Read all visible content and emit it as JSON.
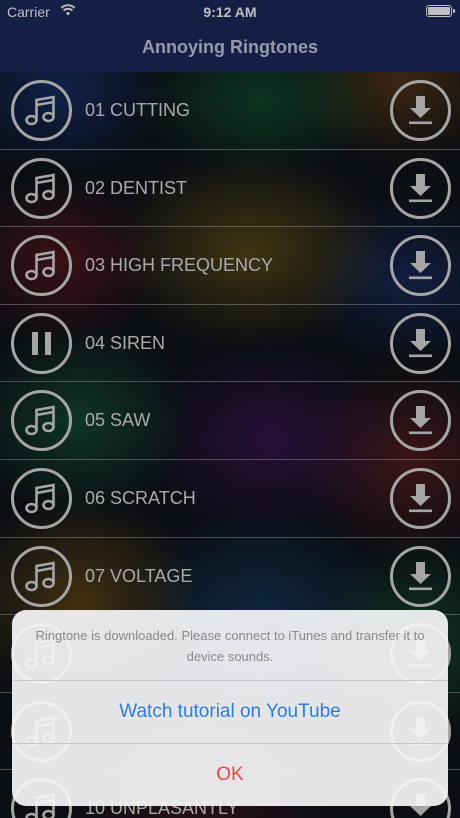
{
  "status_bar": {
    "carrier": "Carrier",
    "time": "9:12 AM"
  },
  "nav": {
    "title": "Annoying Ringtones"
  },
  "ringtones": [
    {
      "label": "01 CUTTING",
      "state": "music-note-icon"
    },
    {
      "label": "02 DENTIST",
      "state": "music-note-icon"
    },
    {
      "label": "03 HIGH FREQUENCY",
      "state": "music-note-icon"
    },
    {
      "label": "04 SIREN",
      "state": "pause-icon"
    },
    {
      "label": "05 SAW",
      "state": "music-note-icon"
    },
    {
      "label": "06 SCRATCH",
      "state": "music-note-icon"
    },
    {
      "label": "07 VOLTAGE",
      "state": "music-note-icon"
    },
    {
      "label": "",
      "state": "music-note-icon"
    },
    {
      "label": "",
      "state": "music-note-icon"
    },
    {
      "label": "10 UNPLASANTLY",
      "state": "music-note-icon"
    }
  ],
  "alert": {
    "message": "Ringtone is downloaded. Please connect to iTunes and transfer it to device sounds.",
    "primary_button": "Watch tutorial on YouTube",
    "cancel_button": "OK",
    "colors": {
      "primary": "#2a7de1",
      "cancel": "#e8483b"
    }
  },
  "colors": {
    "nav_background": "#1c2a5c",
    "row_icon_outline": "#dddddd"
  }
}
